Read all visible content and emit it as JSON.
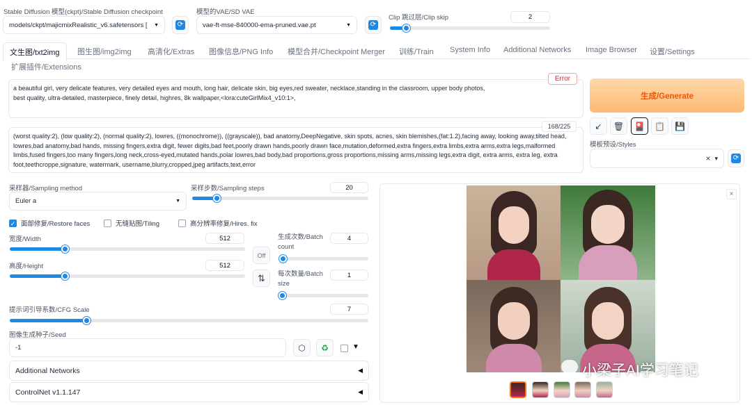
{
  "model": {
    "label": "Stable Diffusion 模型(ckpt)/Stable Diffusion checkpoint",
    "value": "models/ckpt/majicmixRealistic_v6.safetensors [",
    "refresh_icon": "refresh-icon"
  },
  "vae": {
    "label": "模型的VAE/SD VAE",
    "value": "vae-ft-mse-840000-ema-pruned.vae.pt"
  },
  "clip": {
    "label": "Clip 跳过层/Clip skip",
    "value": "2",
    "level": 0.08
  },
  "tabs": [
    "文生图/txt2img",
    "图生图/img2img",
    "高清化/Extras",
    "图像信息/PNG Info",
    "模型合并/Checkpoint Merger",
    "训练/Train",
    "System Info",
    "Additional Networks",
    "Image Browser",
    "设置/Settings",
    "扩展插件/Extensions"
  ],
  "prompt": {
    "text": "a beautiful girl, very delicate features, very detailed eyes and mouth, long hair, delicate skin, big eyes,red sweater, necklace,standing in the classroom, upper body photos,\nbest quality, ultra-detailed, masterpiece, finely detail, highres, 8k wallpaper,<lora:cuteGirlMix4_v10:1>,",
    "badge": "Error"
  },
  "negative": {
    "text": "(worst quality:2), (low quality:2), (normal quality:2), lowres, ((monochrome)), ((grayscale)), bad anatomy,DeepNegative, skin spots, acnes, skin blemishes,(fat:1.2),facing away, looking away,tilted head, lowres,bad anatomy,bad hands, missing fingers,extra digit, fewer digits,bad feet,poorly drawn hands,poorly drawn face,mutation,deformed,extra fingers,extra limbs,extra arms,extra legs,malformed limbs,fused fingers,too many fingers,long neck,cross-eyed,mutated hands,polar lowres,bad body,bad proportions,gross proportions,missing arms,missing legs,extra digit, extra arms, extra leg, extra foot,teethcroppe,signature, watermark, username,blurry,cropped,jpeg artifacts,text,error",
    "token_count": "168/225"
  },
  "generate": {
    "label": "生成/Generate",
    "color": "#f97316"
  },
  "tools": {
    "icons": [
      "arrow-icon",
      "trash-icon",
      "style-card-icon",
      "clipboard-icon",
      "save-icon"
    ],
    "glyphs": [
      "↙",
      "🗑",
      "🎴",
      "📋",
      "💾"
    ]
  },
  "styles": {
    "label": "模板预设/Styles",
    "clear": "×",
    "caret": "▾"
  },
  "sampling": {
    "method_label": "采样器/Sampling method",
    "method_value": "Euler a",
    "steps_label": "采样步数/Sampling steps",
    "steps_value": "20",
    "steps_level": 0.14
  },
  "checks": [
    {
      "label": "面部修复/Restore faces",
      "checked": true
    },
    {
      "label": "无缝贴图/Tiling",
      "checked": false
    },
    {
      "label": "高分辨率修复/Hires. fix",
      "checked": false
    }
  ],
  "width": {
    "label": "宽度/Width",
    "value": "512",
    "level": 0.23
  },
  "height": {
    "label": "高度/Height",
    "value": "512",
    "level": 0.23
  },
  "off_label": "Off",
  "swap_glyph": "⇅",
  "batch_count": {
    "label": "生成次数/Batch count",
    "value": "4",
    "level": 0.02
  },
  "batch_size": {
    "label": "每次数量/Batch size",
    "value": "1",
    "level": 0.0
  },
  "cfg": {
    "label": "提示词引导系数/CFG Scale",
    "value": "7",
    "level": 0.21
  },
  "seed": {
    "label": "图像生成种子/Seed",
    "value": "-1",
    "dice_glyph": "⬡",
    "recycle_glyph": "♻",
    "extra_caret": "▼"
  },
  "accordions": [
    {
      "label": "Additional Networks",
      "tri": "◀"
    },
    {
      "label": "ControlNet v1.1.147",
      "tri": "◀"
    }
  ],
  "gallery": {
    "close": "×",
    "watermark": "小梁子AI学习笔记"
  }
}
